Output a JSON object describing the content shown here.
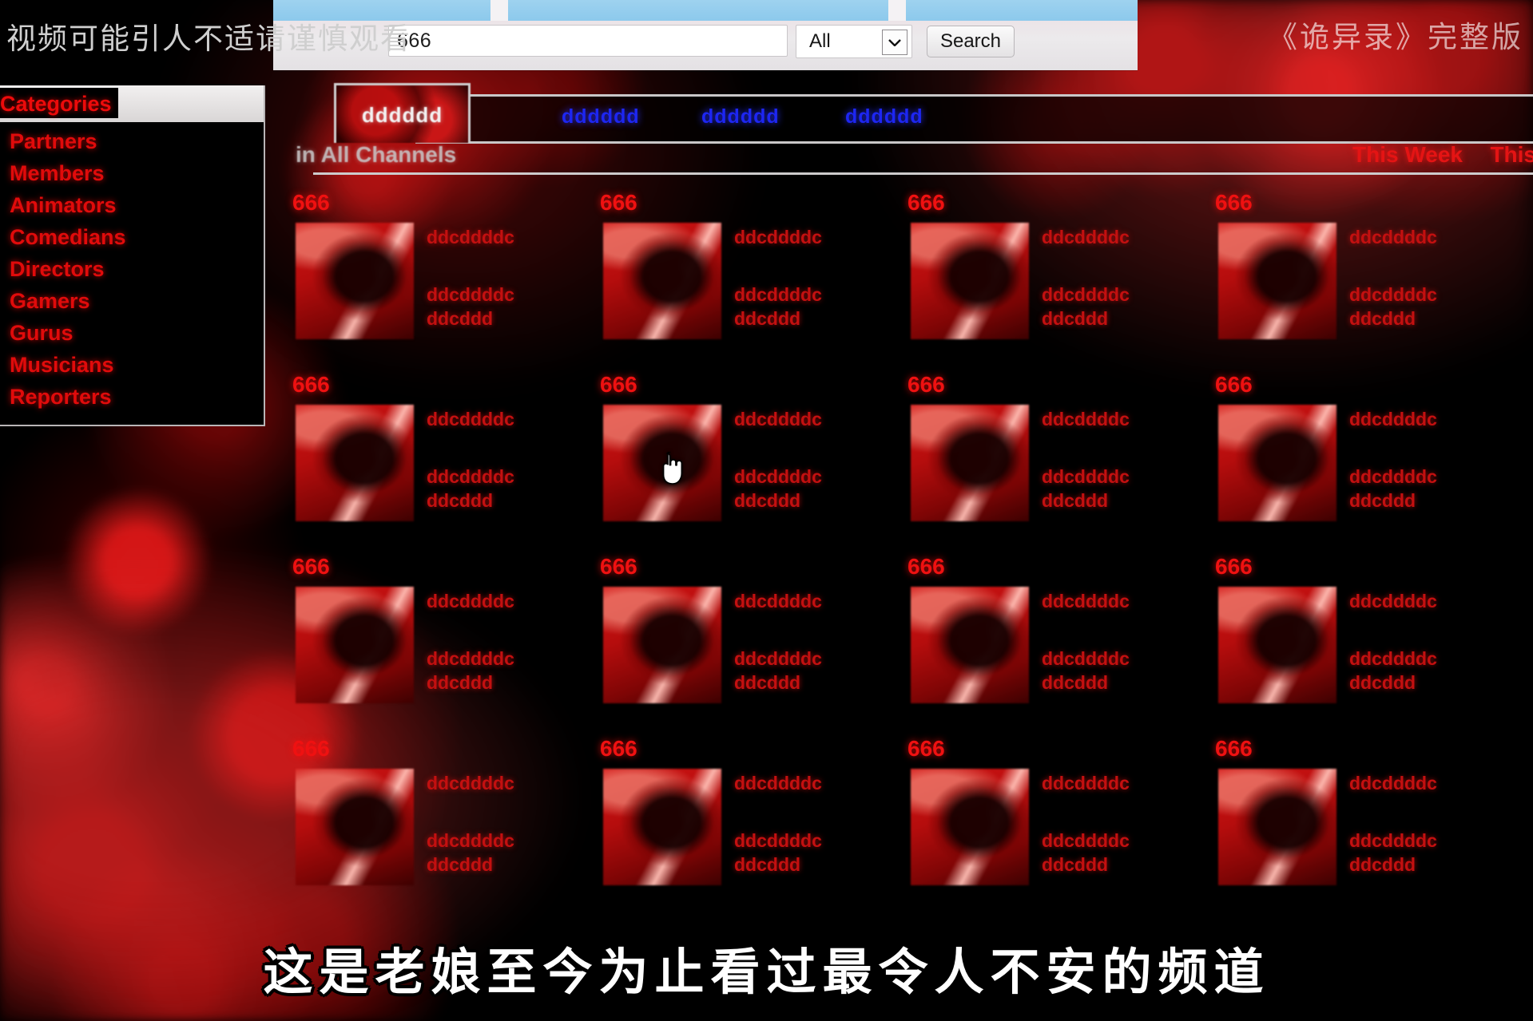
{
  "overlay": {
    "warning_text": "视频可能引人不适请谨慎观看",
    "title_right": "《诡异录》完整版",
    "subtitle": "这是老娘至今为止看过最令人不安的频道"
  },
  "browser": {
    "search": {
      "value": "666",
      "placeholder": "",
      "scope_selected": "All",
      "scope_options": [
        "All"
      ],
      "submit_label": "Search"
    }
  },
  "sidebar": {
    "header": "Categories",
    "items": [
      {
        "label": "Partners"
      },
      {
        "label": "Members"
      },
      {
        "label": "Animators"
      },
      {
        "label": "Comedians"
      },
      {
        "label": "Directors"
      },
      {
        "label": "Gamers"
      },
      {
        "label": "Gurus"
      },
      {
        "label": "Musicians"
      },
      {
        "label": "Reporters"
      }
    ]
  },
  "tabs": {
    "active": {
      "label": "dddddd"
    },
    "links": [
      {
        "label": "dddddd"
      },
      {
        "label": "dddddd"
      },
      {
        "label": "dddddd"
      }
    ]
  },
  "subbar": {
    "scope_text": "in All Channels",
    "ranges": [
      {
        "label": "This Week"
      },
      {
        "label": "This"
      }
    ]
  },
  "grid": {
    "cards": [
      {
        "title": "666",
        "lines": [
          "ddcddddc",
          "ddcddddc",
          "ddcddd"
        ]
      },
      {
        "title": "666",
        "lines": [
          "ddcddddc",
          "ddcddddc",
          "ddcddd"
        ]
      },
      {
        "title": "666",
        "lines": [
          "ddcddddc",
          "ddcddddc",
          "ddcddd"
        ]
      },
      {
        "title": "666",
        "lines": [
          "ddcddddc",
          "ddcddddc",
          "ddcddd"
        ]
      },
      {
        "title": "666",
        "lines": [
          "ddcddddc",
          "ddcddddc",
          "ddcddd"
        ]
      },
      {
        "title": "666",
        "lines": [
          "ddcddddc",
          "ddcddddc",
          "ddcddd"
        ]
      },
      {
        "title": "666",
        "lines": [
          "ddcddddc",
          "ddcddddc",
          "ddcddd"
        ]
      },
      {
        "title": "666",
        "lines": [
          "ddcddddc",
          "ddcddddc",
          "ddcddd"
        ]
      },
      {
        "title": "666",
        "lines": [
          "ddcddddc",
          "ddcddddc",
          "ddcddd"
        ]
      },
      {
        "title": "666",
        "lines": [
          "ddcddddc",
          "ddcddddc",
          "ddcddd"
        ]
      },
      {
        "title": "666",
        "lines": [
          "ddcddddc",
          "ddcddddc",
          "ddcddd"
        ]
      },
      {
        "title": "666",
        "lines": [
          "ddcddddc",
          "ddcddddc",
          "ddcddd"
        ]
      },
      {
        "title": "666",
        "lines": [
          "ddcddddc",
          "ddcddddc",
          "ddcddd"
        ]
      },
      {
        "title": "666",
        "lines": [
          "ddcddddc",
          "ddcddddc",
          "ddcddd"
        ]
      },
      {
        "title": "666",
        "lines": [
          "ddcddddc",
          "ddcddddc",
          "ddcddd"
        ]
      },
      {
        "title": "666",
        "lines": [
          "ddcddddc",
          "ddcddddc",
          "ddcddd"
        ]
      }
    ]
  },
  "colors": {
    "blood_red": "#ef1111",
    "link_blue": "#1d26f2",
    "chrome_gray": "#eceaec",
    "tabstrip_blue": "#8cc9ec"
  }
}
